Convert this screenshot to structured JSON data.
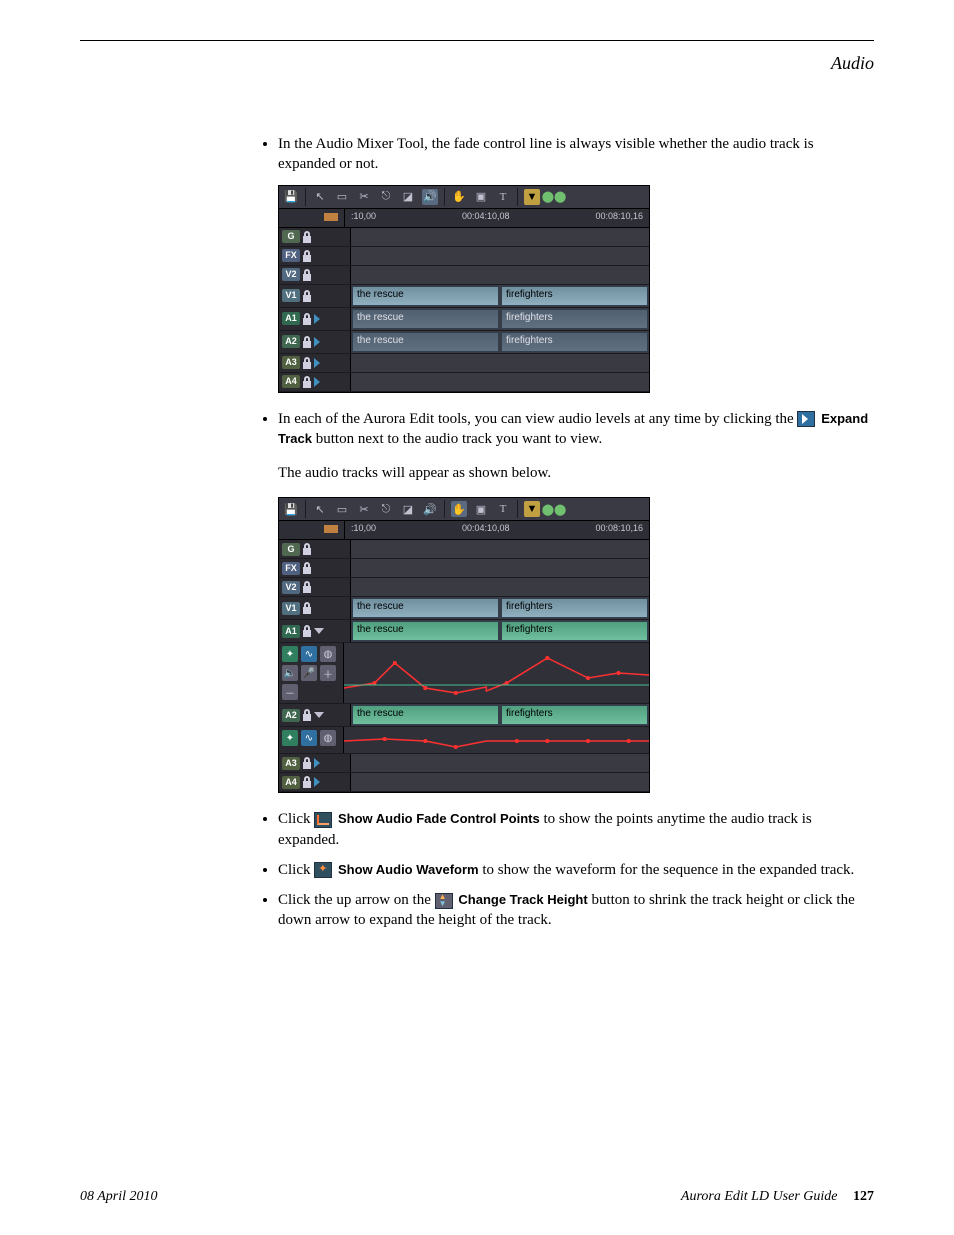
{
  "section_header": "Audio",
  "bullets_top": {
    "item1": "In the Audio Mixer Tool, the fade control line is always visible whether the audio track is expanded or not."
  },
  "timeline": {
    "ticks": {
      "t1": ":10,00",
      "t2": "00:04:10,08",
      "t3": "00:08:10,16"
    },
    "tracks": {
      "g": {
        "label": "G"
      },
      "fx": {
        "label": "FX"
      },
      "v2": {
        "label": "V2"
      },
      "v1": {
        "label": "V1",
        "clip1": "the rescue",
        "clip2": "firefighters"
      },
      "a1": {
        "label": "A1",
        "clip1": "the rescue",
        "clip2": "firefighters"
      },
      "a2": {
        "label": "A2",
        "clip1": "the rescue",
        "clip2": "firefighters"
      },
      "a3": {
        "label": "A3"
      },
      "a4": {
        "label": "A4"
      }
    }
  },
  "bullets_mid": {
    "item1_a": "In each of the Aurora Edit tools, you can view audio levels at any time by clicking the ",
    "item1_btn": "Expand Track",
    "item1_b": " button next to the audio track you want to view."
  },
  "para_mid": "The audio tracks will appear as shown below.",
  "bullets_bottom": {
    "item1_a": "Click ",
    "item1_btn": "Show Audio Fade Control Points",
    "item1_b": " to show the points anytime the audio track is expanded.",
    "item2_a": "Click ",
    "item2_btn": "Show Audio Waveform",
    "item2_b": " to show the waveform for the sequence in the expanded track.",
    "item3_a": "Click the up arrow on the ",
    "item3_btn": "Change Track Height",
    "item3_b": " button to shrink the track height or click the down arrow to expand the height of the track."
  },
  "footer": {
    "date": "08 April 2010",
    "book": "Aurora Edit LD User Guide",
    "page": "127"
  }
}
